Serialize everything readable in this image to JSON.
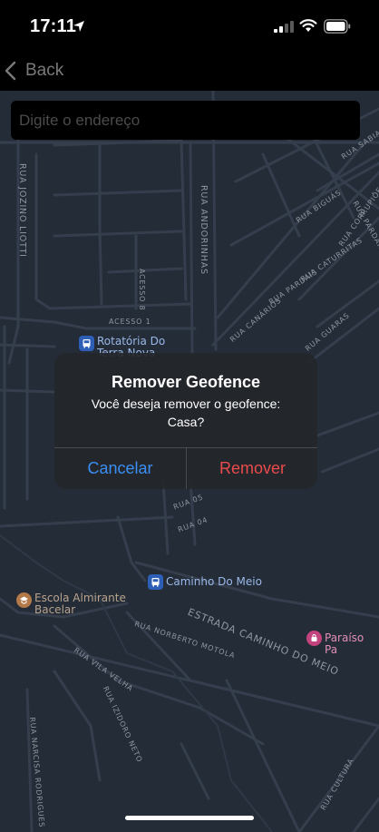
{
  "status_bar": {
    "time": "17:11"
  },
  "nav": {
    "back_label": "Back"
  },
  "search": {
    "placeholder": "Digite o endereço",
    "value": ""
  },
  "map": {
    "streets": [
      "RUA JOZINO LIOTTI",
      "RUA ANDORINHAS",
      "ACESSO 8",
      "ACESSO 1",
      "RUA BIGUÁS",
      "RUA CATURRITAS",
      "RUA CORRUPIÕES",
      "RUA PARDAIS",
      "RUA CANÁRIOS",
      "RUA GUARAS",
      "RUA 05",
      "RUA 04",
      "ESTRADA CAMINHO DO MEIO",
      "RUA NORBERTO MOTOLA",
      "RUA VILA VELHA",
      "RUA IZIDORO NETO",
      "RUA NARCISA RODRIGUES",
      "RUA CULTURA",
      "RUA SABIA",
      "RUA PARDAIS"
    ],
    "pois": [
      {
        "name_line1": "Rotatória Do",
        "name_line2": "Terra Nova",
        "icon": "bus-icon"
      },
      {
        "name_line1": "Caminho Do Meio",
        "name_line2": "",
        "icon": "bus-icon"
      },
      {
        "name_line1": "Escola Almirante",
        "name_line2": "Bacelar",
        "icon": "school-icon"
      },
      {
        "name_line1": "Paraíso Pa",
        "name_line2": "",
        "icon": "shopping-icon"
      }
    ]
  },
  "alert": {
    "title": "Remover Geofence",
    "message": "Você deseja remover o geofence: Casa?",
    "cancel_label": "Cancelar",
    "confirm_label": "Remover",
    "colors": {
      "cancel": "#3b8ff4",
      "confirm": "#ea4b4b"
    }
  }
}
